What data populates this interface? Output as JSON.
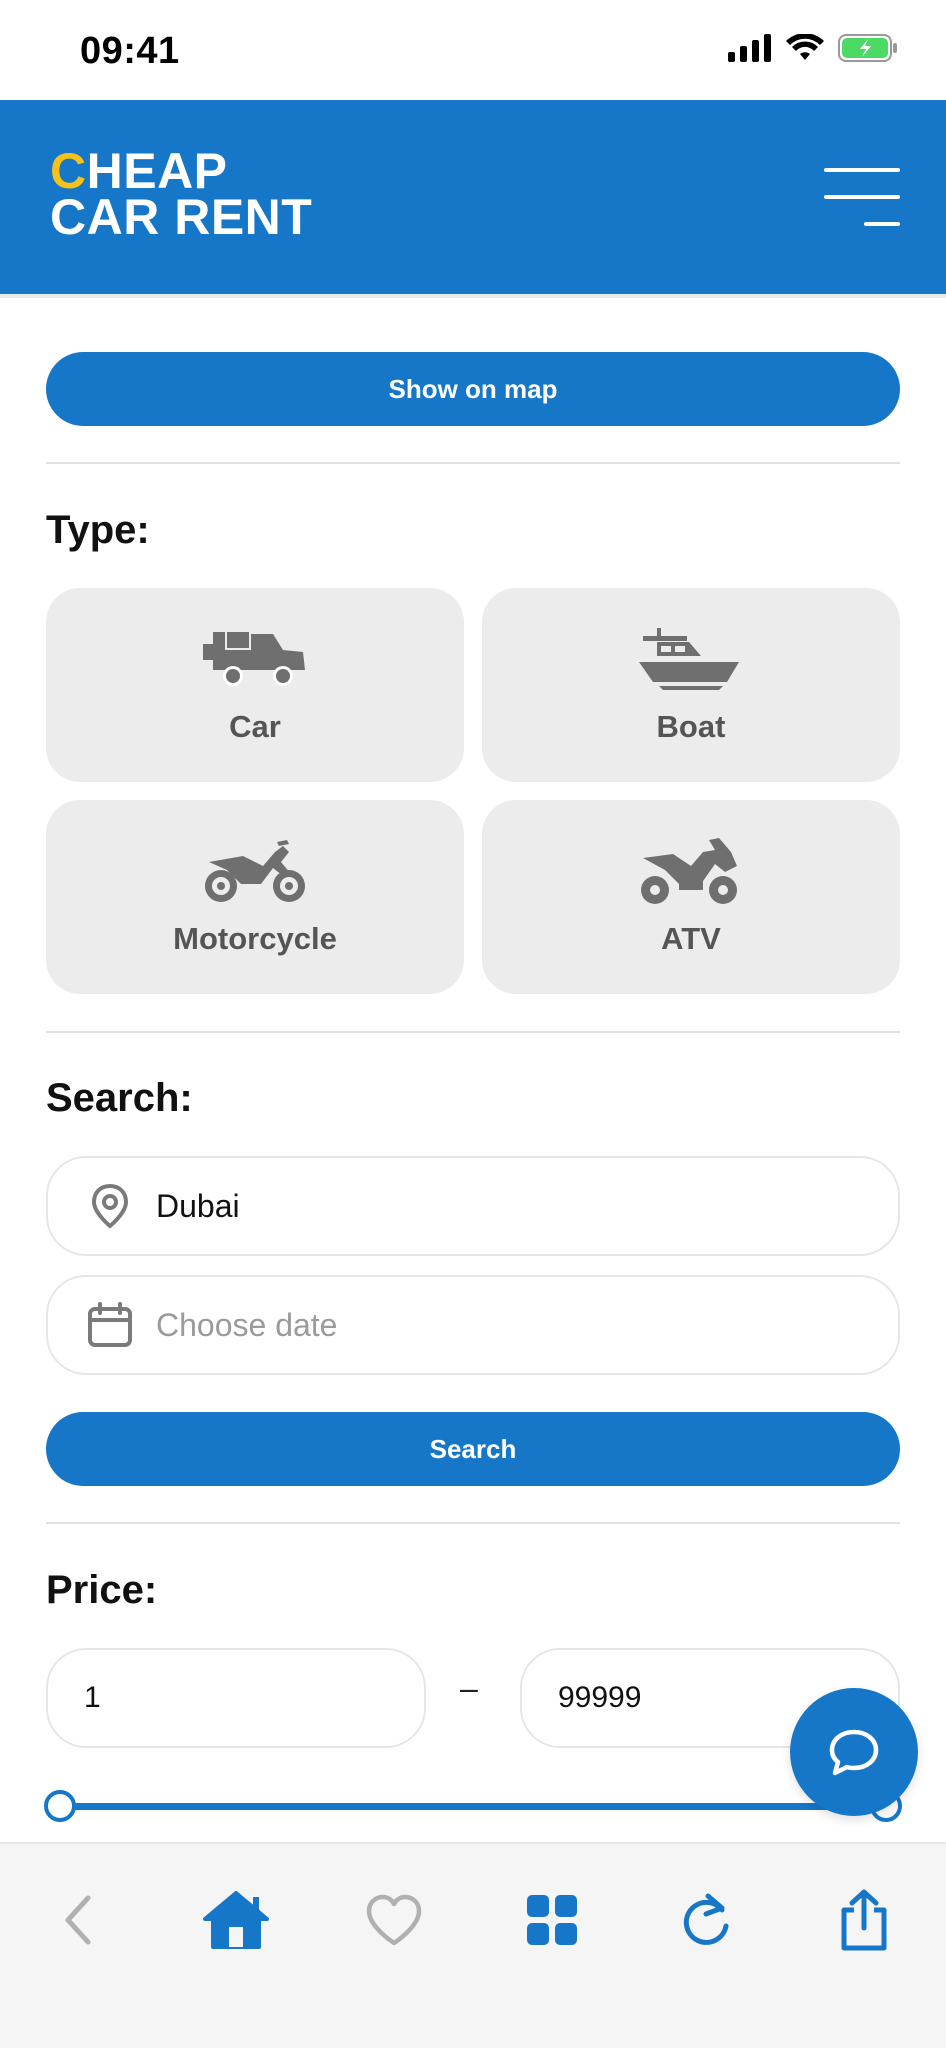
{
  "status_bar": {
    "time": "09:41"
  },
  "header": {
    "logo_line1_first": "C",
    "logo_line1_rest": "HEAP",
    "logo_line2": "CAR RENT"
  },
  "map_button": {
    "label": "Show on map"
  },
  "type_section": {
    "title": "Type:",
    "items": [
      {
        "label": "Car",
        "icon": "truck-icon"
      },
      {
        "label": "Boat",
        "icon": "boat-icon"
      },
      {
        "label": "Motorcycle",
        "icon": "motorcycle-icon"
      },
      {
        "label": "ATV",
        "icon": "atv-icon"
      }
    ]
  },
  "search_section": {
    "title": "Search:",
    "location_value": "Dubai",
    "date_placeholder": "Choose date",
    "button_label": "Search"
  },
  "price_section": {
    "title": "Price:",
    "min": "1",
    "separator": "–",
    "max": "99999",
    "slider_min_fraction": 0,
    "slider_max_fraction": 1
  },
  "colors": {
    "accent": "#1677c8",
    "logo_accent": "#f4c21a",
    "card_bg": "#ececec",
    "icon_gray": "#6f6f6f"
  },
  "bottom_bar": {
    "items": [
      "back-icon",
      "home-icon",
      "heart-icon",
      "grid-icon",
      "reload-icon",
      "share-icon"
    ]
  }
}
